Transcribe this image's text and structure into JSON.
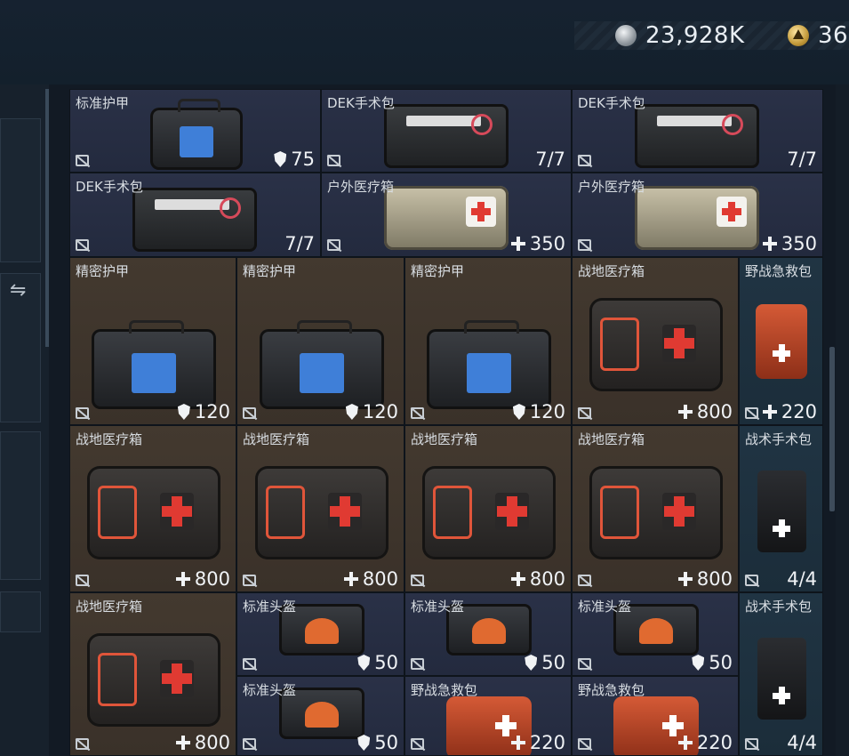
{
  "currencies": [
    {
      "icon": "silver-coin-icon",
      "amount": "23,928K"
    },
    {
      "icon": "gold-coin-icon",
      "amount": "36"
    }
  ],
  "items": [
    {
      "name": "标准护甲",
      "value": "75",
      "stat": "shield",
      "kind": "armor"
    },
    {
      "name": "DEK手术包",
      "value": "7/7",
      "stat": "none",
      "kind": "kitbag"
    },
    {
      "name": "DEK手术包",
      "value": "7/7",
      "stat": "none",
      "kind": "kitbag"
    },
    {
      "name": "DEK手术包",
      "value": "7/7",
      "stat": "none",
      "kind": "kitbag"
    },
    {
      "name": "户外医疗箱",
      "value": "350",
      "stat": "plus",
      "kind": "outdoor"
    },
    {
      "name": "户外医疗箱",
      "value": "350",
      "stat": "plus",
      "kind": "outdoor"
    },
    {
      "name": "精密护甲",
      "value": "120",
      "stat": "shield",
      "kind": "armor"
    },
    {
      "name": "精密护甲",
      "value": "120",
      "stat": "shield",
      "kind": "armor"
    },
    {
      "name": "精密护甲",
      "value": "120",
      "stat": "shield",
      "kind": "armor"
    },
    {
      "name": "战地医疗箱",
      "value": "800",
      "stat": "plus",
      "kind": "firstaid"
    },
    {
      "name": "野战急救包",
      "value": "220",
      "stat": "plus",
      "kind": "redkit"
    },
    {
      "name": "战地医疗箱",
      "value": "800",
      "stat": "plus",
      "kind": "firstaid"
    },
    {
      "name": "战地医疗箱",
      "value": "800",
      "stat": "plus",
      "kind": "firstaid"
    },
    {
      "name": "战地医疗箱",
      "value": "800",
      "stat": "plus",
      "kind": "firstaid"
    },
    {
      "name": "战地医疗箱",
      "value": "800",
      "stat": "plus",
      "kind": "firstaid"
    },
    {
      "name": "战术手术包",
      "value": "4/4",
      "stat": "none",
      "kind": "tactical"
    },
    {
      "name": "战地医疗箱",
      "value": "800",
      "stat": "plus",
      "kind": "firstaid"
    },
    {
      "name": "标准头盔",
      "value": "50",
      "stat": "shield",
      "kind": "helmet"
    },
    {
      "name": "标准头盔",
      "value": "50",
      "stat": "shield",
      "kind": "helmet"
    },
    {
      "name": "标准头盔",
      "value": "50",
      "stat": "shield",
      "kind": "helmet"
    },
    {
      "name": "战术手术包",
      "value": "4/4",
      "stat": "none",
      "kind": "tactical"
    },
    {
      "name": "标准头盔",
      "value": "50",
      "stat": "shield",
      "kind": "helmet"
    },
    {
      "name": "野战急救包",
      "value": "220",
      "stat": "plus",
      "kind": "redbag"
    },
    {
      "name": "野战急救包",
      "value": "220",
      "stat": "plus",
      "kind": "redbag"
    }
  ]
}
